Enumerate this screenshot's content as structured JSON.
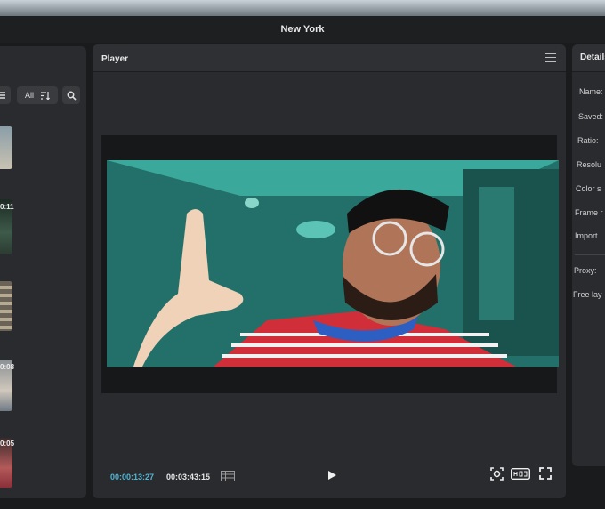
{
  "app": {
    "title": "New York"
  },
  "library": {
    "toolbar": {
      "filter_all_label": "All"
    },
    "clip_durations": [
      "0:11",
      "0:08",
      "0:05"
    ]
  },
  "player": {
    "title": "Player",
    "current_timecode": "00:00:13:27",
    "total_timecode": "00:03:43:15",
    "accent_color": "#4fb6d6"
  },
  "details": {
    "title": "Details",
    "fields": [
      "Name:",
      "Saved:",
      "Ratio:",
      "Resolu",
      "Color s",
      "Frame r",
      "Import"
    ],
    "proxy_label": "Proxy:",
    "free_layer_label": "Free lay"
  }
}
